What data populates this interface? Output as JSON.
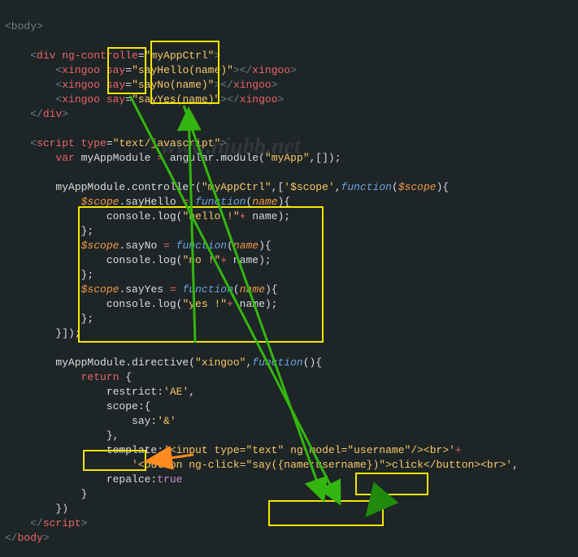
{
  "watermark": "www.njubb.net",
  "code": {
    "l1": "<body>",
    "l2": "",
    "l3a": "    <",
    "l3b": "div",
    "l3c": " ng-controlle",
    "l3d": "=",
    "l3e": "\"myAppCtrl\"",
    "l3f": ">",
    "l4a": "        <",
    "l4b": "xingoo",
    "l4c": " say",
    "l4d": "=",
    "l4e": "\"sayHello(name)\"",
    "l4f": "></",
    "l4g": "xingoo",
    "l4h": ">",
    "l5a": "        <",
    "l5b": "xingoo",
    "l5c": " say",
    "l5d": "=",
    "l5e": "\"sayNo(name)\"",
    "l5f": "></",
    "l5g": "xingoo",
    "l5h": ">",
    "l6a": "        <",
    "l6b": "xingoo",
    "l6c": " say",
    "l6d": "=",
    "l6e": "\"sayYes(name)\"",
    "l6f": "></",
    "l6g": "xingoo",
    "l6h": ">",
    "l7a": "    </",
    "l7b": "div",
    "l7c": ">",
    "l8": "",
    "l9a": "    <",
    "l9b": "script",
    "l9c": " type",
    "l9d": "=",
    "l9e": "\"text/javascript\"",
    "l9f": ">",
    "l10a": "        ",
    "l10b": "var",
    "l10c": " myAppModule ",
    "l10d": "=",
    "l10e": " angular.module(",
    "l10f": "\"myApp\"",
    "l10g": ",[]);",
    "l11": "",
    "l12a": "        myAppModule.controller(",
    "l12b": "\"myAppCtrl\"",
    "l12c": ",[",
    "l12d": "'$scope'",
    "l12e": ",",
    "l12f": "function",
    "l12g": "(",
    "l12h": "$scope",
    "l12i": "){",
    "l13a": "            ",
    "l13b": "$scope",
    "l13c": ".sayHello ",
    "l13d": "=",
    "l13e": " ",
    "l13f": "function",
    "l13g": "(",
    "l13h": "name",
    "l13i": "){",
    "l14a": "                console.log(",
    "l14b": "\"hello !\"",
    "l14c": "+",
    "l14d": " name);",
    "l15": "            };",
    "l16a": "            ",
    "l16b": "$scope",
    "l16c": ".sayNo ",
    "l16d": "=",
    "l16e": " ",
    "l16f": "function",
    "l16g": "(",
    "l16h": "name",
    "l16i": "){",
    "l17a": "                console.log(",
    "l17b": "\"no !\"",
    "l17c": "+",
    "l17d": " name);",
    "l18": "            };",
    "l19a": "            ",
    "l19b": "$scope",
    "l19c": ".sayYes ",
    "l19d": "=",
    "l19e": " ",
    "l19f": "function",
    "l19g": "(",
    "l19h": "name",
    "l19i": "){",
    "l20a": "                console.log(",
    "l20b": "\"yes !\"",
    "l20c": "+",
    "l20d": " name);",
    "l21": "            };",
    "l22": "        }]);",
    "l23": "",
    "l24a": "        myAppModule.directive(",
    "l24b": "\"xingoo\"",
    "l24c": ",",
    "l24d": "function",
    "l24e": "(){",
    "l25a": "            ",
    "l25b": "return",
    "l25c": " {",
    "l26a": "                restrict:",
    "l26b": "'AE'",
    "l26c": ",",
    "l27": "                scope:{",
    "l28a": "                    say:",
    "l28b": "'&'",
    "l29": "                },",
    "l30a": "                template:",
    "l30b": "'<input type=\"text\" ng-model=\"username\"/><br>'",
    "l30c": "+",
    "l31a": "                    ",
    "l31b": "'<button ng-click=\"say({name:username})\">click</button><br>'",
    "l31c": ",",
    "l32a": "                repalce:",
    "l32b": "true",
    "l33": "            }",
    "l34": "        })",
    "l35a": "    </",
    "l35b": "script",
    "l35c": ">",
    "l36a": "</",
    "l36b": "body",
    "l36c": ">"
  },
  "annotations": {
    "boxes": [
      "box-say-attrs",
      "box-say-calls",
      "box-scope-fns",
      "box-say-amp",
      "box-username",
      "box-nameuser"
    ],
    "arrows": [
      "orange-arrow",
      "green-arrow-1",
      "green-arrow-2",
      "green-arrow-3"
    ]
  }
}
